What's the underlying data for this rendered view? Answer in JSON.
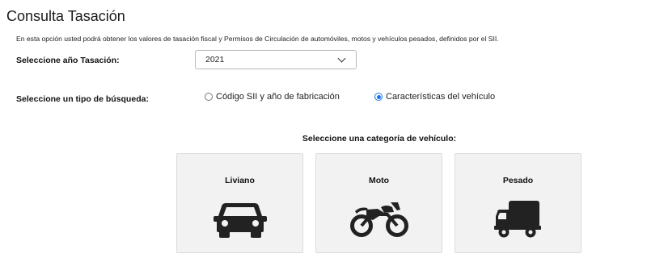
{
  "page": {
    "title": "Consulta Tasación",
    "intro": "En esta opción usted podrá obtener los valores de tasación fiscal y Permisos de Circulación de automóviles, motos y vehículos pesados, definidos por el SII."
  },
  "year_row": {
    "label": "Seleccione año Tasación:",
    "selected": "2021"
  },
  "search_type": {
    "label": "Seleccione un tipo de búsqueda:",
    "options": [
      {
        "label": "Código SII y año de fabricación",
        "checked": false
      },
      {
        "label": "Características del vehículo",
        "checked": true
      }
    ]
  },
  "categories": {
    "heading": "Seleccione una categoría de vehículo:",
    "items": [
      {
        "label": "Liviano",
        "icon": "car-icon"
      },
      {
        "label": "Moto",
        "icon": "motorcycle-icon"
      },
      {
        "label": "Pesado",
        "icon": "truck-icon"
      }
    ]
  },
  "colors": {
    "accent": "#1a73e8",
    "icon": "#222222",
    "card_bg": "#f2f2f2"
  }
}
